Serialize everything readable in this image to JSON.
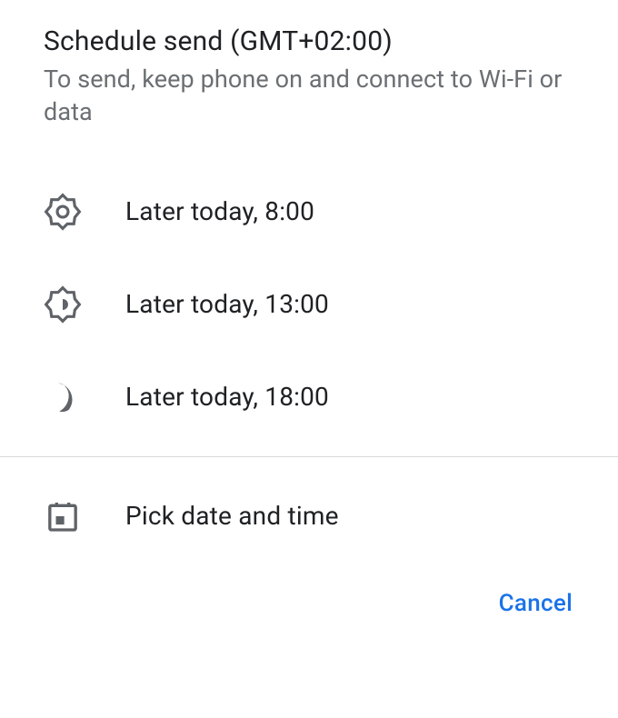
{
  "header": {
    "title": "Schedule send (GMT+02:00)",
    "subtitle": "To send, keep phone on and connect to Wi-Fi or data"
  },
  "options": [
    {
      "icon": "brightness-high-icon",
      "label": "Later today, 8:00"
    },
    {
      "icon": "brightness-medium-icon",
      "label": "Later today, 13:00"
    },
    {
      "icon": "moon-icon",
      "label": "Later today, 18:00"
    }
  ],
  "pick": {
    "icon": "calendar-icon",
    "label": "Pick date and time"
  },
  "footer": {
    "cancel": "Cancel"
  },
  "colors": {
    "text_primary": "#202124",
    "text_secondary": "#6b6f73",
    "icon": "#5f6368",
    "accent": "#1a73e8",
    "divider": "#d7d9db"
  }
}
